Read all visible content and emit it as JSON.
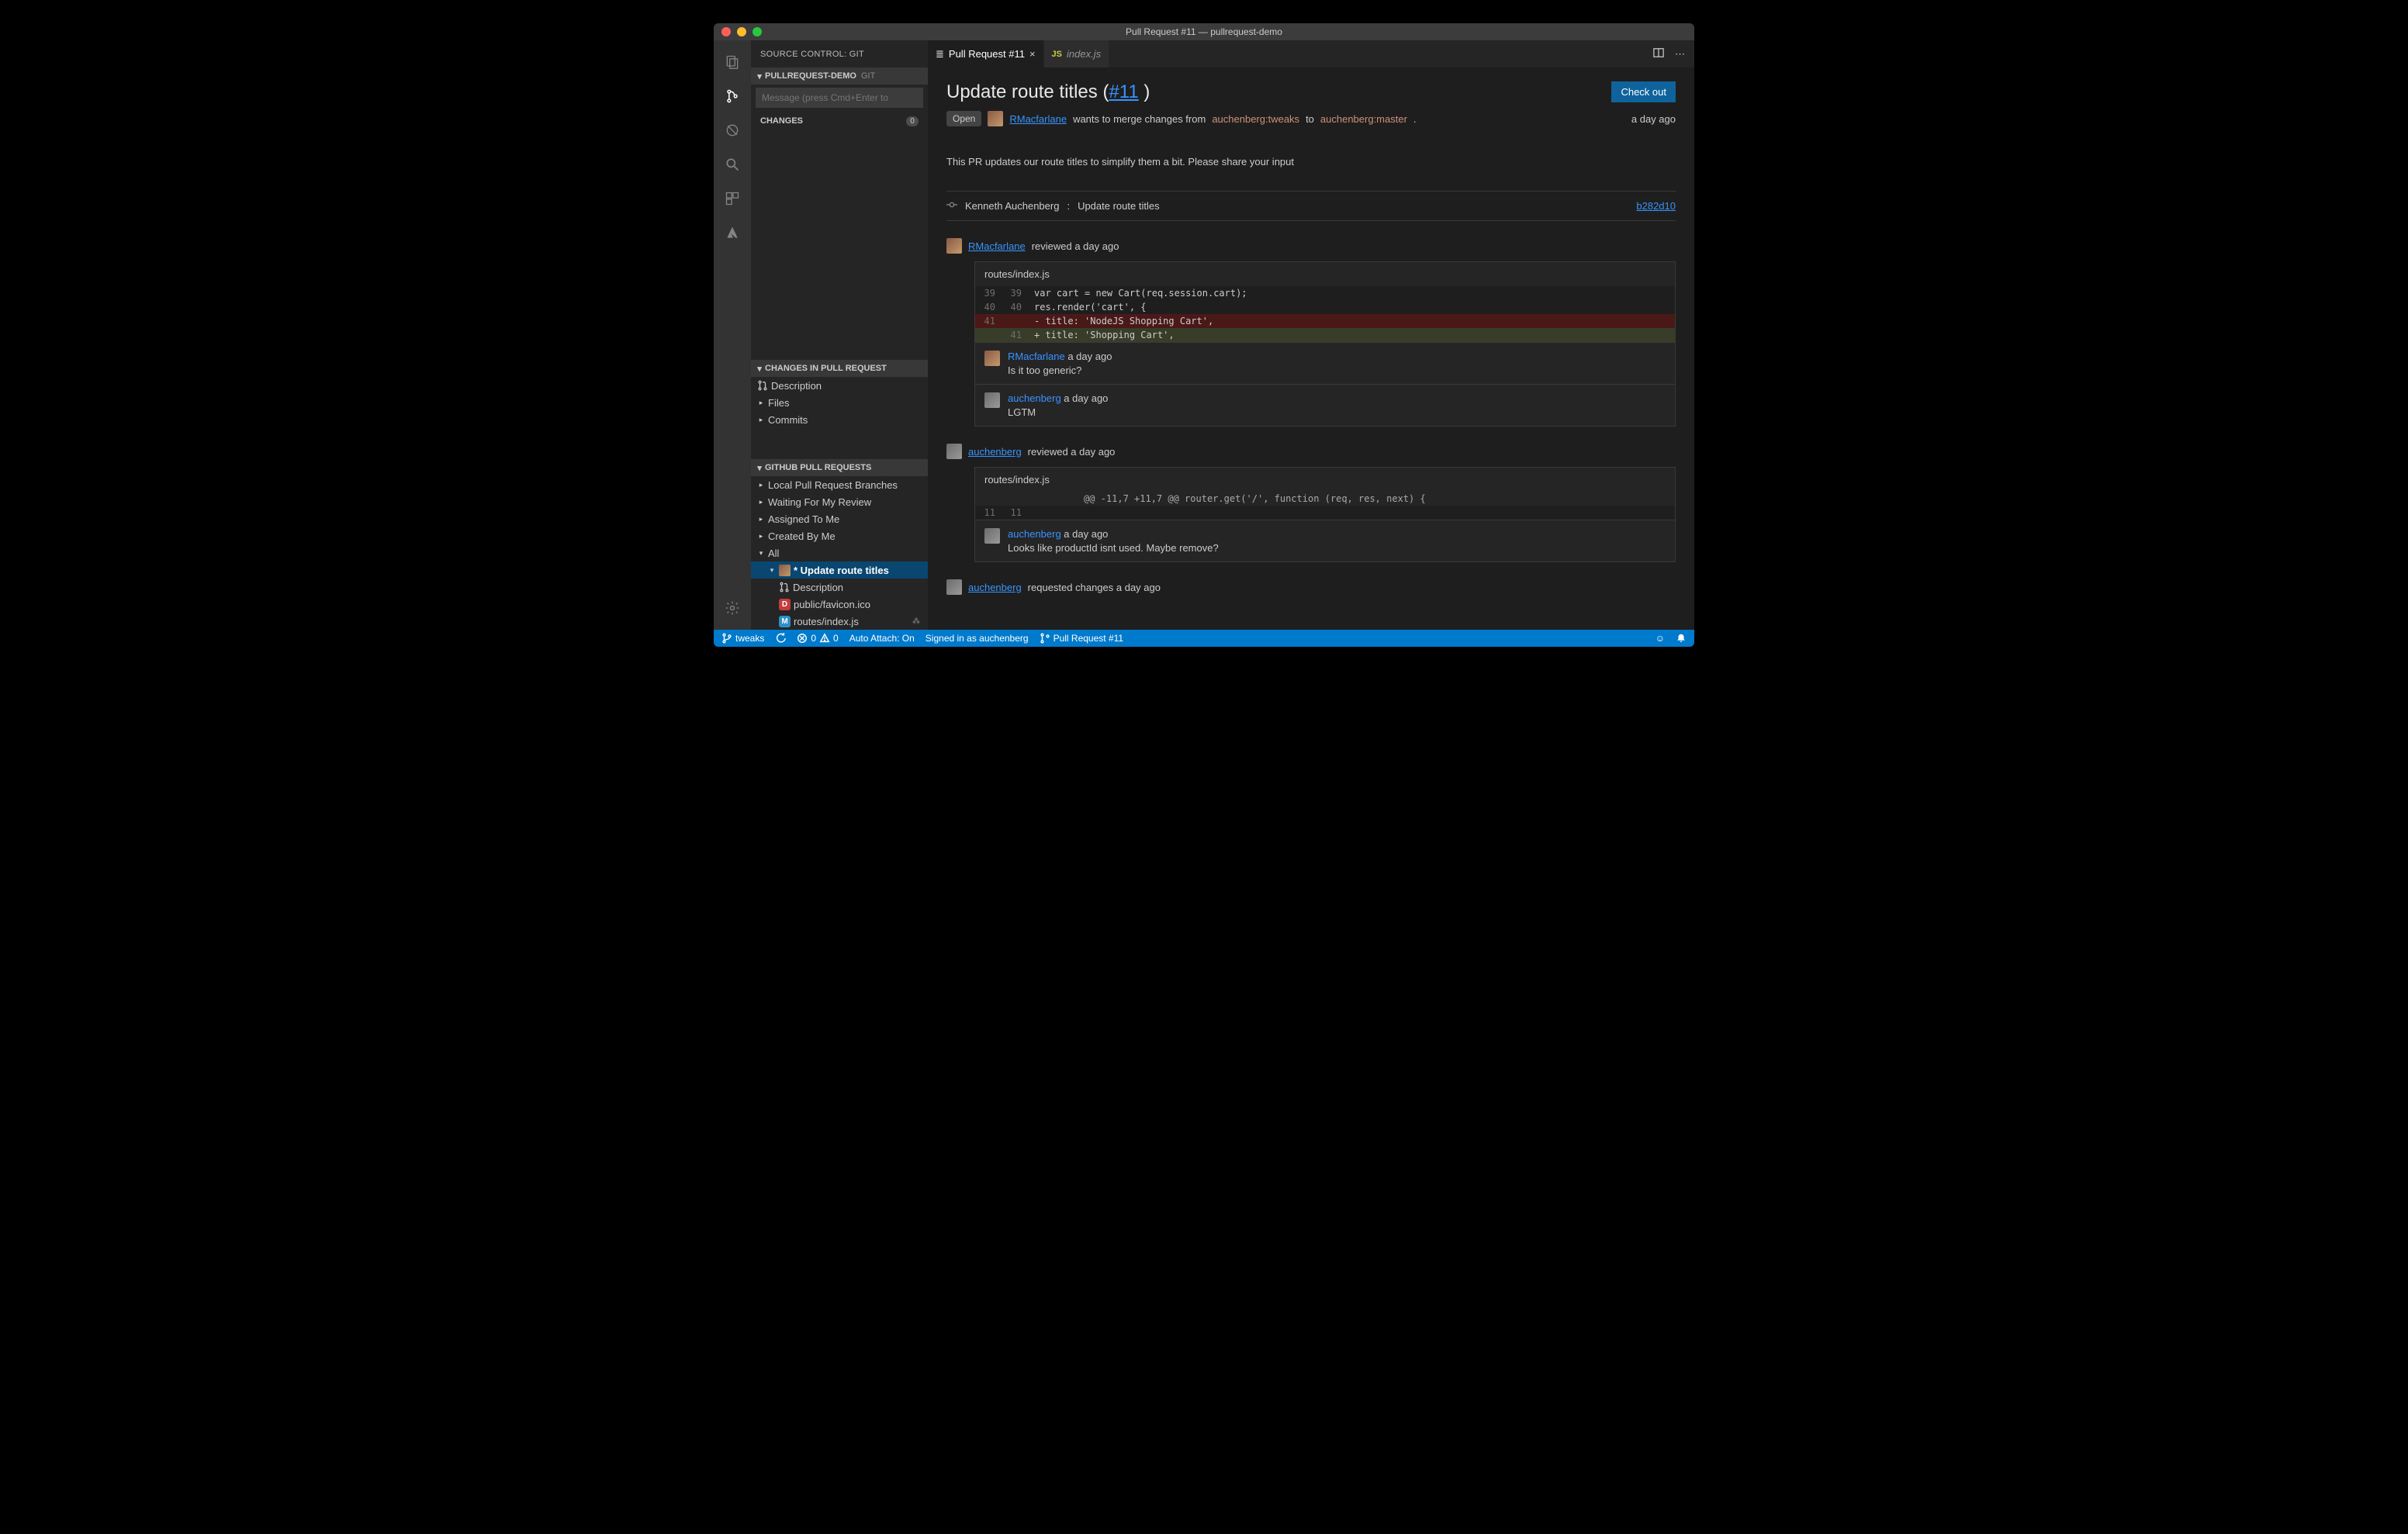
{
  "window": {
    "title": "Pull Request #11 — pullrequest-demo"
  },
  "sidebar": {
    "title": "SOURCE CONTROL: GIT",
    "repo_header": "PULLREQUEST-DEMO",
    "repo_sub": "GIT",
    "message_placeholder": "Message (press Cmd+Enter to",
    "changes_label": "CHANGES",
    "changes_count": "0",
    "pr_changes_header": "CHANGES IN PULL REQUEST",
    "pr_changes_items": [
      "Description",
      "Files",
      "Commits"
    ],
    "gh_header": "GITHUB PULL REQUESTS",
    "gh_groups": [
      "Local Pull Request Branches",
      "Waiting For My Review",
      "Assigned To Me",
      "Created By Me",
      "All"
    ],
    "gh_selected": "* Update route titles",
    "gh_selected_children": [
      {
        "label": "Description",
        "icon": "pr"
      },
      {
        "label": "public/favicon.ico",
        "badge": "D"
      },
      {
        "label": "routes/index.js",
        "badge": "M"
      }
    ]
  },
  "tabs": [
    {
      "label": "Pull Request #11",
      "active": true
    },
    {
      "label": "index.js",
      "active": false,
      "js": true
    }
  ],
  "pr": {
    "title_prefix": "Update route titles (",
    "title_link": "#11",
    "title_suffix": " )",
    "checkout": "Check out",
    "state": "Open",
    "author": "RMacfarlane",
    "merge_mid": " wants to merge changes from ",
    "from_branch": "auchenberg:tweaks",
    "to_word": " to ",
    "to_branch": "auchenberg:master",
    "period": ".",
    "time": "a day ago",
    "description": "This PR updates our route titles to simplify them a bit. Please share your input",
    "commit": {
      "author": "Kenneth Auchenberg",
      "msg": "Update route titles",
      "sha": "b282d10"
    },
    "reviews": [
      {
        "user": "RMacfarlane",
        "action": "reviewed a day ago",
        "file": "routes/index.js",
        "diff": [
          {
            "type": "ctx",
            "l": "39",
            "r": "39",
            "text": "var cart = new Cart(req.session.cart);"
          },
          {
            "type": "ctx",
            "l": "40",
            "r": "40",
            "text": "res.render('cart', {"
          },
          {
            "type": "del",
            "l": "41",
            "r": "",
            "text": "- title: 'NodeJS Shopping Cart',"
          },
          {
            "type": "add",
            "l": "",
            "r": "41",
            "text": "+ title: 'Shopping Cart',"
          }
        ],
        "comments": [
          {
            "user": "RMacfarlane",
            "time": "a day ago",
            "body": "Is it too generic?"
          },
          {
            "user": "auchenberg",
            "time": "a day ago",
            "body": "LGTM"
          }
        ]
      },
      {
        "user": "auchenberg",
        "action": "reviewed a day ago",
        "file": "routes/index.js",
        "diff": [
          {
            "type": "hunk",
            "text": "@@ -11,7 +11,7 @@ router.get('/', function (req, res, next) {"
          },
          {
            "type": "ctx",
            "l": "11",
            "r": "11",
            "text": ""
          }
        ],
        "comments": [
          {
            "user": "auchenberg",
            "time": "a day ago",
            "body": "Looks like productId isnt used. Maybe remove?"
          }
        ]
      }
    ],
    "final_event": {
      "user": "auchenberg",
      "action": "requested changes a day ago"
    }
  },
  "statusbar": {
    "branch": "tweaks",
    "errors": "0",
    "warnings": "0",
    "auto_attach": "Auto Attach: On",
    "signed_in": "Signed in as auchenberg",
    "pr": "Pull Request #11"
  }
}
